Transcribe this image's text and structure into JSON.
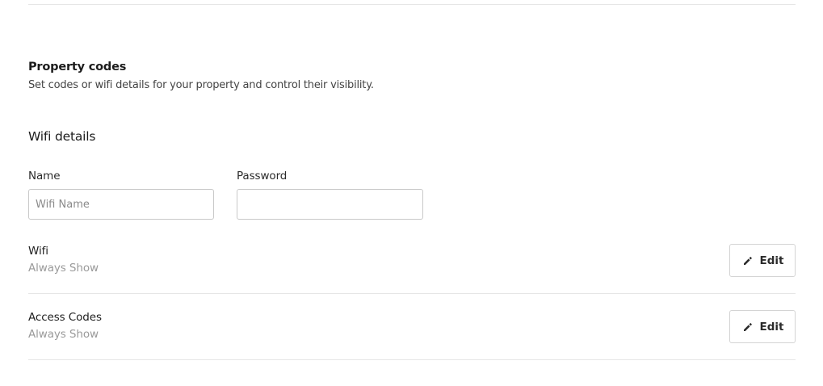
{
  "property_codes": {
    "title": "Property codes",
    "description": "Set codes or wifi details for your property and control their visibility."
  },
  "wifi_details": {
    "title": "Wifi details",
    "name_label": "Name",
    "name_placeholder": "Wifi Name",
    "name_value": "",
    "password_label": "Password",
    "password_value": ""
  },
  "rows": [
    {
      "title": "Wifi",
      "visibility": "Always Show",
      "edit_label": "Edit",
      "edit_icon": "pencil-icon"
    },
    {
      "title": "Access Codes",
      "visibility": "Always Show",
      "edit_label": "Edit",
      "edit_icon": "pencil-icon"
    }
  ]
}
